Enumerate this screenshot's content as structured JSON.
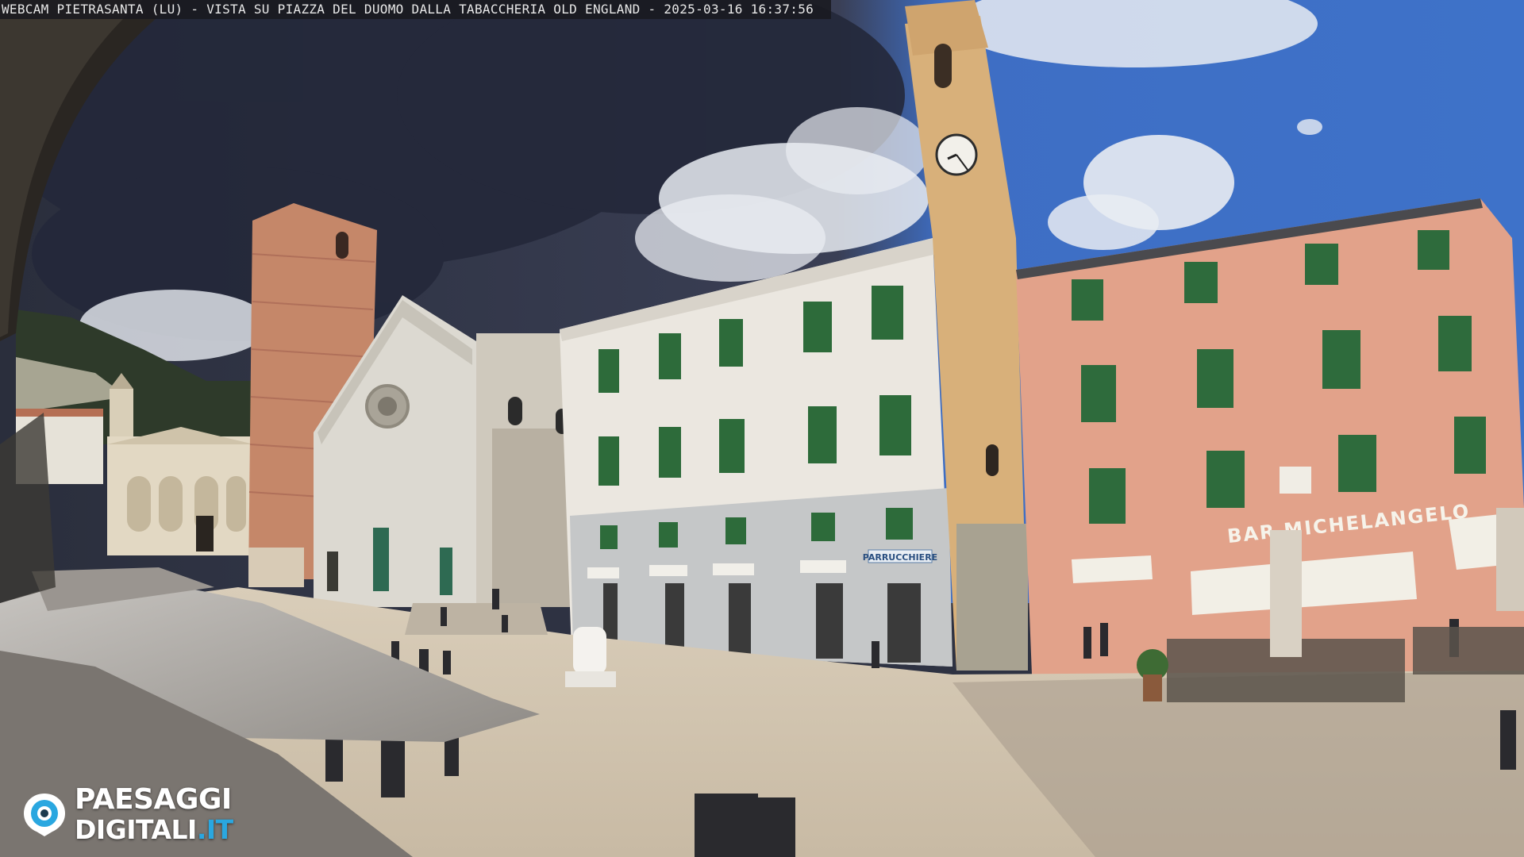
{
  "overlay": {
    "caption": "WEBCAM PIETRASANTA (LU) - VISTA SU PIAZZA DEL DUOMO DALLA TABACCHERIA OLD ENGLAND - 2025-03-16 16:37:56"
  },
  "scene": {
    "shop_sign": "PARRUCCHIERE",
    "bar_sign": "BAR MICHELANGELO",
    "clock_time": "16:37"
  },
  "logo": {
    "line1": "PAESAGGI",
    "line2_main": "DIGITALI",
    "line2_accent": ".IT",
    "mark_icon": "camera-lens-icon",
    "accent_color": "#2aa7e0"
  },
  "colors": {
    "sky_dark": "#2b2f40",
    "sky_blue": "#3f6fc4",
    "pink_building": "#e4a48c",
    "white_building": "#ece8e1",
    "paving": "#d7cbb8",
    "campanile_brick": "#c98a6b"
  }
}
